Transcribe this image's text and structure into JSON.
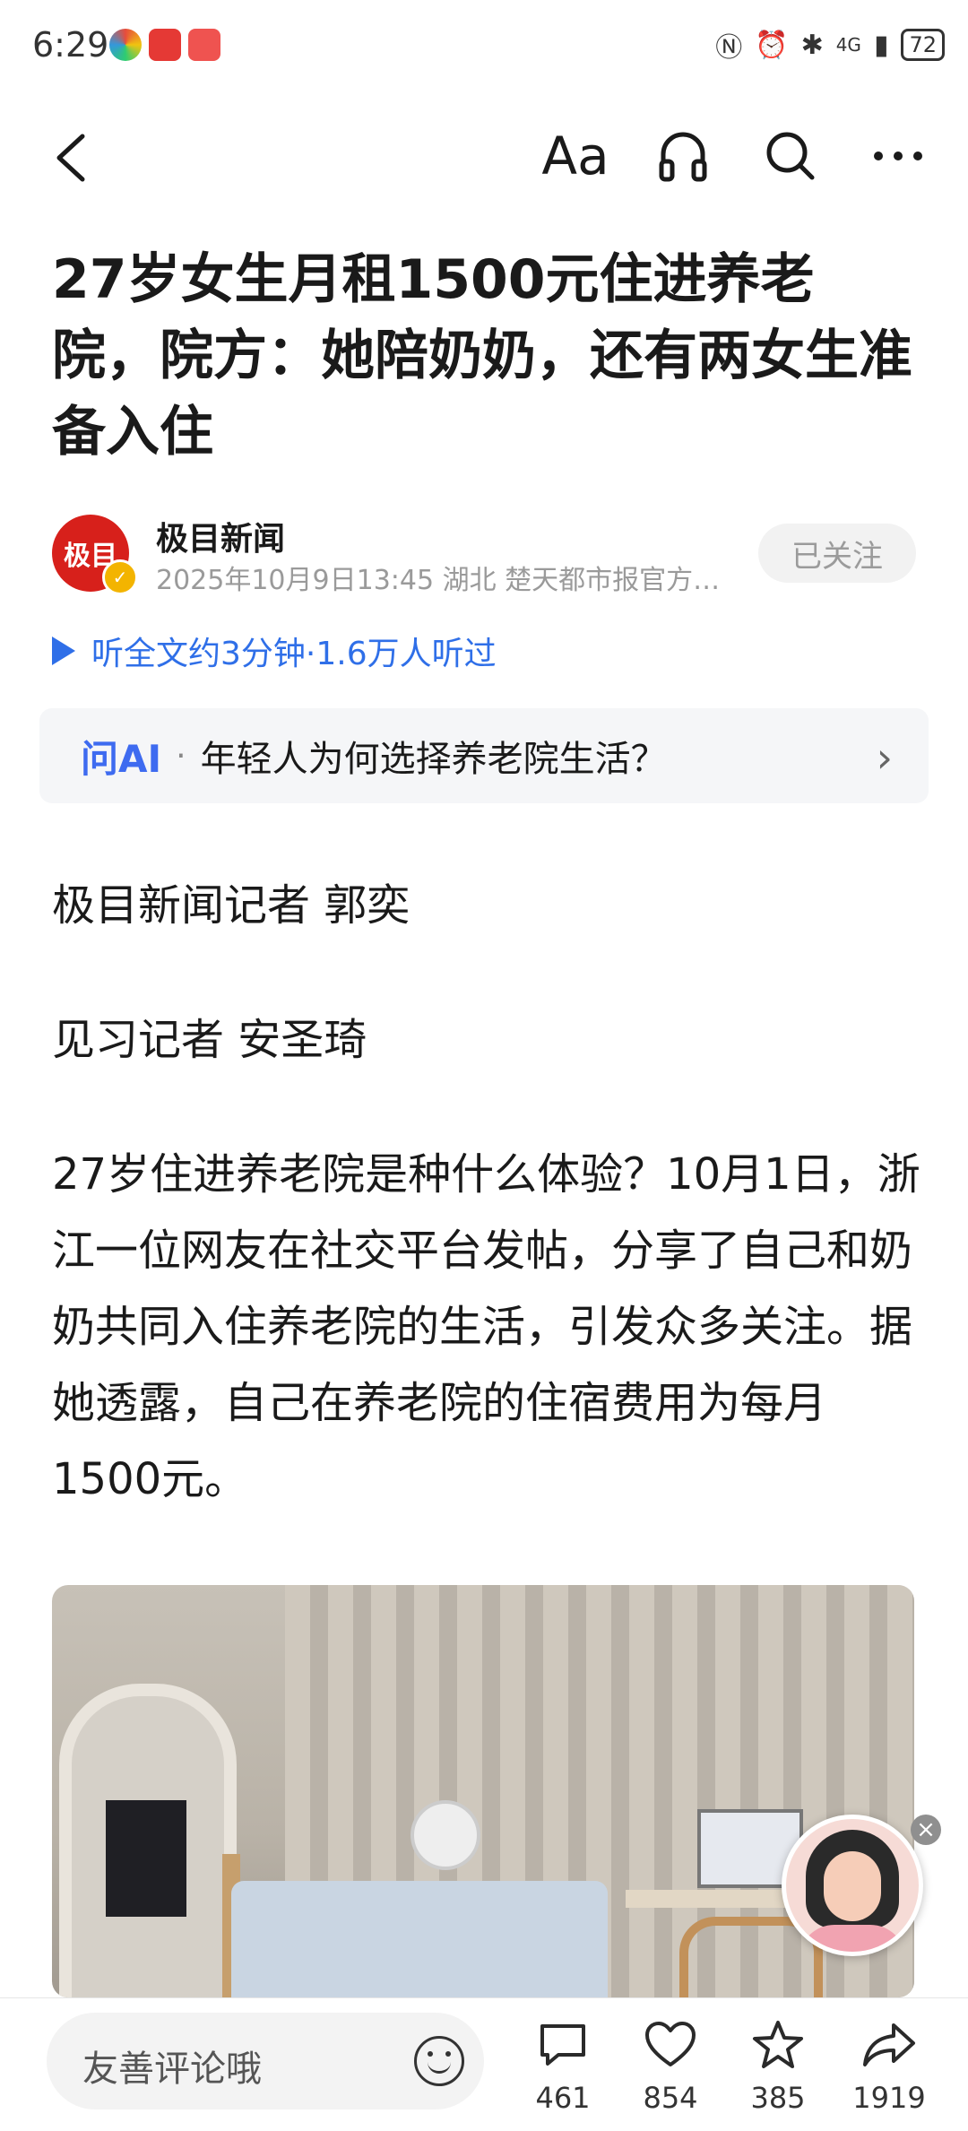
{
  "status_bar": {
    "time": "6:29",
    "signal": "4G",
    "battery": "72"
  },
  "nav": {
    "back_icon": "back-arrow-icon",
    "font_size_icon_text": "Aa",
    "icons": [
      "font-size-icon",
      "headphones-icon",
      "search-icon",
      "more-icon"
    ]
  },
  "article": {
    "title": "27岁女生月租1500元住进养老院，院方：她陪奶奶，还有两女生准备入住",
    "source": {
      "name": "极目新闻",
      "avatar_text": "极目",
      "meta": "2025年10月9日13:45 湖北 楚天都市报官方…",
      "follow_label": "已关注"
    },
    "listen_label": "听全文约3分钟·1.6万人听过",
    "ask_ai": {
      "label": "问AI",
      "separator": "·",
      "question": "年轻人为何选择养老院生活？"
    },
    "paragraphs": [
      "极目新闻记者 郭奕",
      "见习记者 安圣琦",
      "27岁住进养老院是种什么体验？10月1日，浙江一位网友在社交平台发帖，分享了自己和奶奶共同入住养老院的生活，引发众多关注。据她透露，自己在养老院的住宿费用为每月1500元。"
    ]
  },
  "bottom_bar": {
    "comment_placeholder": "友善评论哦",
    "actions": [
      {
        "name": "comments",
        "icon": "comment-icon",
        "count": "461"
      },
      {
        "name": "likes",
        "icon": "heart-icon",
        "count": "854"
      },
      {
        "name": "favorites",
        "icon": "star-icon",
        "count": "385"
      },
      {
        "name": "shares",
        "icon": "share-icon",
        "count": "1919"
      }
    ]
  },
  "colors": {
    "accent_blue": "#2f6fe8",
    "ai_blue": "#3e6bf0",
    "brand_red": "#d7201b"
  }
}
